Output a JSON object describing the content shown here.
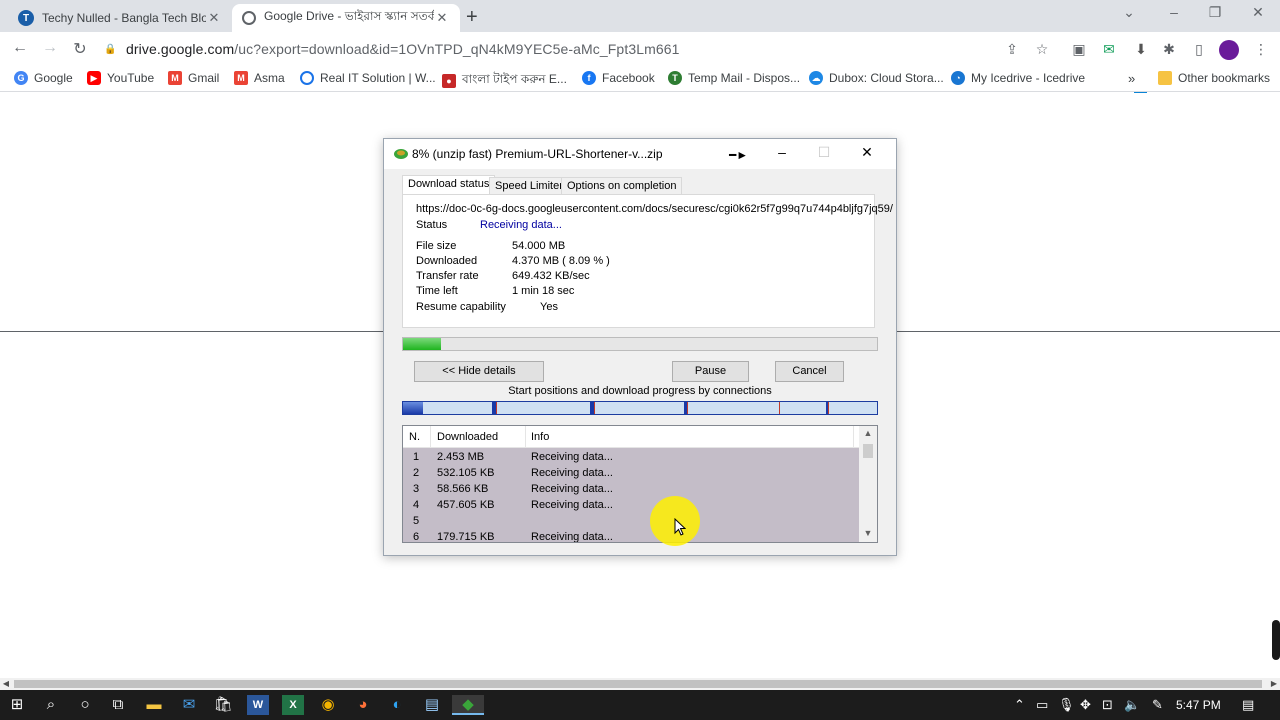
{
  "browser": {
    "tabs": [
      {
        "title": "Techy Nulled - Bangla Tech Blogger",
        "active": false
      },
      {
        "title": "Google Drive - ভাইরাস স্ক্যান সতর্কতা",
        "active": true
      }
    ],
    "url_host": "drive.google.com",
    "url_path": "/uc?export=download&id=1OVnTPD_qN4kM9YEC5e-aMc_Fpt3Lm661",
    "bookmarks": [
      {
        "label": "Google",
        "icon": "google-icon",
        "color": "#4285f4"
      },
      {
        "label": "YouTube",
        "icon": "youtube-icon",
        "color": "#ff0000"
      },
      {
        "label": "Gmail",
        "icon": "gmail-icon",
        "color": "#ea4335"
      },
      {
        "label": "Asma",
        "icon": "gmail-icon",
        "color": "#ea4335"
      },
      {
        "label": "Real IT Solution | W...",
        "icon": "globe-icon",
        "color": "#1a73e8"
      },
      {
        "label": "বাংলা টাইপ করুন E...",
        "icon": "record-icon",
        "color": "#c62828"
      },
      {
        "label": "Facebook",
        "icon": "facebook-icon",
        "color": "#1877f2"
      },
      {
        "label": "Temp Mail - Dispos...",
        "icon": "tempmail-icon",
        "color": "#2e7d32"
      },
      {
        "label": "Dubox: Cloud Stora...",
        "icon": "cloud-icon",
        "color": "#1e88e5"
      },
      {
        "label": "My Icedrive - Icedrive",
        "icon": "icedrive-icon",
        "color": "#1976d2"
      }
    ],
    "more_bookmarks": "»",
    "other_bookmarks": "Other bookmarks",
    "extension_badge": "off"
  },
  "dialog": {
    "title": "8% (unzip fast) Premium-URL-Shortener-v...zip",
    "tabs": [
      "Download status",
      "Speed Limiter",
      "Options on completion"
    ],
    "url": "https://doc-0c-6g-docs.googleusercontent.com/docs/securesc/cgi0k62r5f7g99q7u744p4bljfg7jq59/",
    "status_label": "Status",
    "status_value": "Receiving data...",
    "fields": [
      {
        "label": "File size",
        "value": "54.000  MB"
      },
      {
        "label": "Downloaded",
        "value": "4.370  MB  ( 8.09 % )"
      },
      {
        "label": "Transfer rate",
        "value": "649.432  KB/sec"
      },
      {
        "label": "Time left",
        "value": "1 min 18 sec"
      },
      {
        "label": "Resume capability",
        "value": "Yes"
      }
    ],
    "progress_percent": 8.09,
    "hide_details_label": "<< Hide details",
    "pause_label": "Pause",
    "cancel_label": "Cancel",
    "connections_caption": "Start positions and download progress by connections",
    "list_headers": [
      "N.",
      "Downloaded",
      "Info"
    ],
    "connections": [
      {
        "n": "1",
        "downloaded": "2.453  MB",
        "info": "Receiving data..."
      },
      {
        "n": "2",
        "downloaded": "532.105  KB",
        "info": "Receiving data..."
      },
      {
        "n": "3",
        "downloaded": "58.566  KB",
        "info": "Receiving data..."
      },
      {
        "n": "4",
        "downloaded": "457.605  KB",
        "info": "Receiving data..."
      },
      {
        "n": "5",
        "downloaded": "",
        "info": ""
      },
      {
        "n": "6",
        "downloaded": "179.715  KB",
        "info": "Receiving data..."
      }
    ]
  },
  "taskbar": {
    "clock": "5:47 PM"
  }
}
